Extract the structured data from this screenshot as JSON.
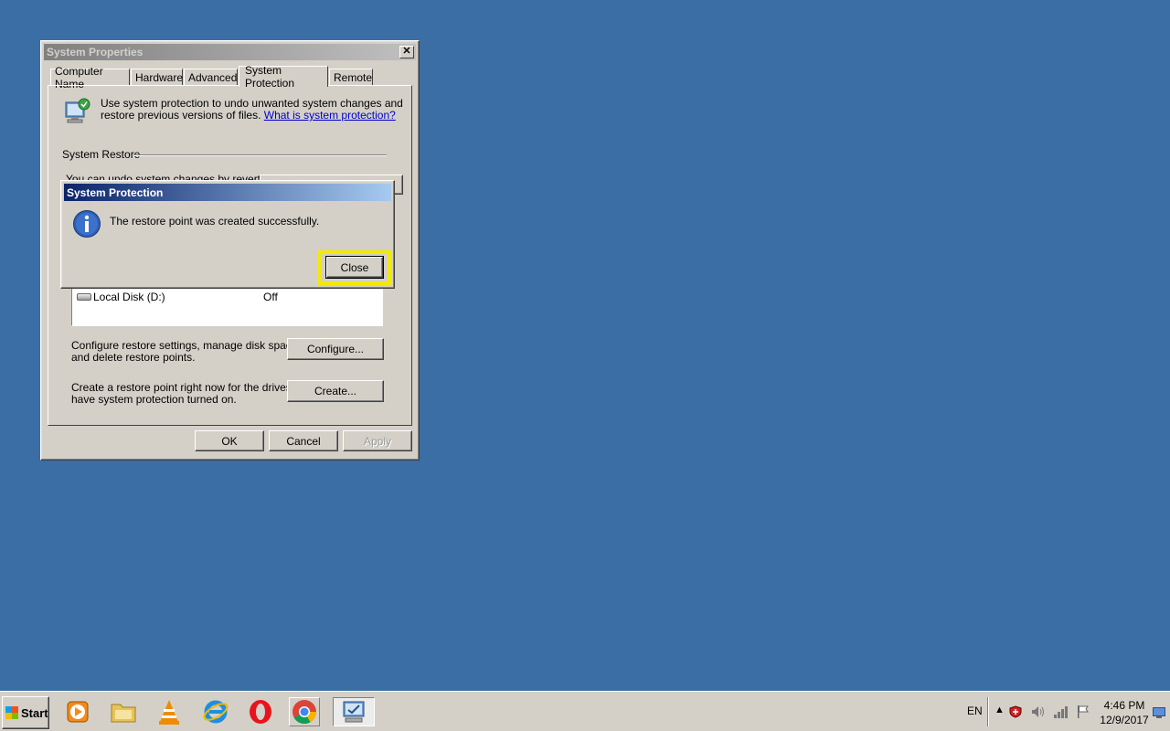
{
  "system_properties": {
    "title": "System Properties",
    "tabs": [
      "Computer Name",
      "Hardware",
      "Advanced",
      "System Protection",
      "Remote"
    ],
    "selected_tab": "System Protection",
    "intro_text_1": "Use system protection to undo unwanted system changes and",
    "intro_text_2": "restore previous versions of files.",
    "intro_link": "What is system protection?",
    "system_restore_label": "System Restore",
    "undo_text_partial": "You can undo system changes by reverting",
    "drive_row": {
      "name": "Local Disk (D:)",
      "protection": "Off"
    },
    "configure_text_1": "Configure restore settings, manage disk space,",
    "configure_text_2": "and delete restore points.",
    "configure_button": "Configure...",
    "create_text_1": "Create a restore point right now for the drives that",
    "create_text_2": "have system protection turned on.",
    "create_button": "Create...",
    "ok_button": "OK",
    "cancel_button": "Cancel",
    "apply_button": "Apply"
  },
  "message_dialog": {
    "title": "System Protection",
    "message": "The restore point was created successfully.",
    "close_button": "Close",
    "highlight_color": "#f2ea00"
  },
  "taskbar": {
    "start_label": "Start",
    "apps": [
      "media-player-icon",
      "file-explorer-icon",
      "vlc-icon",
      "internet-explorer-icon",
      "opera-icon",
      "chrome-icon",
      "system-properties-icon"
    ],
    "language": "EN",
    "time": "4:46 PM",
    "date": "12/9/2017"
  }
}
